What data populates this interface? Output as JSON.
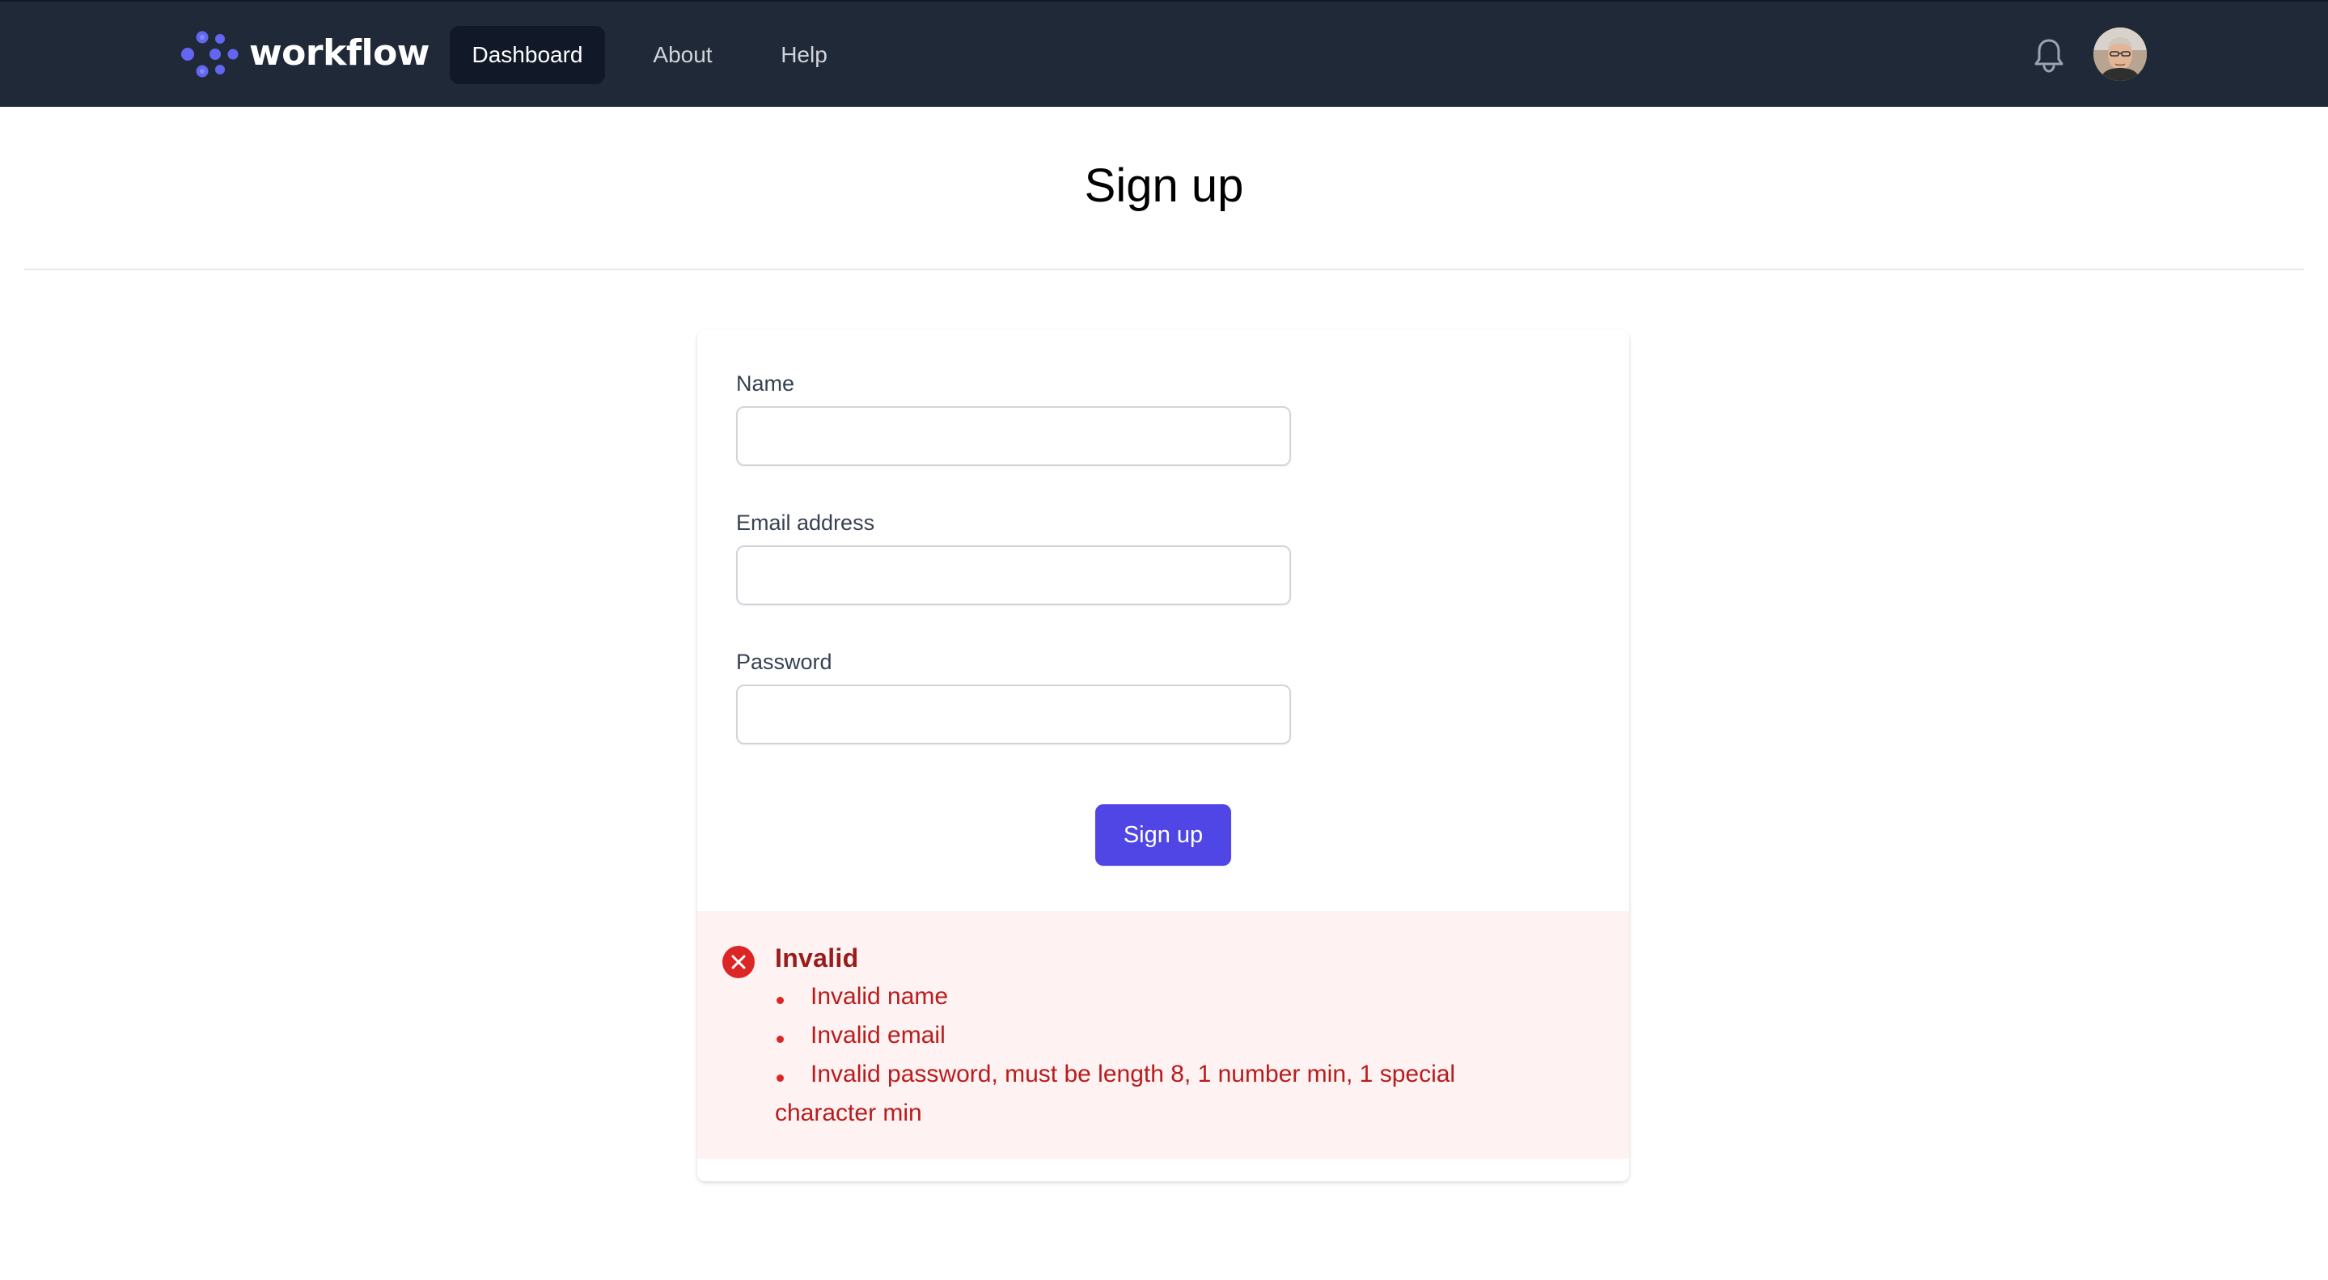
{
  "app": {
    "brand": "workflow",
    "brand_color": "#6366f1"
  },
  "navbar": {
    "background": "#1f2937",
    "links": [
      {
        "label": "Dashboard",
        "active": true
      },
      {
        "label": "About",
        "active": false
      },
      {
        "label": "Help",
        "active": false
      }
    ],
    "notification_icon": "bell-icon",
    "avatar": "user-avatar"
  },
  "page": {
    "title": "Sign up"
  },
  "form": {
    "fields": [
      {
        "label": "Name",
        "value": "",
        "placeholder": ""
      },
      {
        "label": "Email address",
        "value": "",
        "placeholder": ""
      },
      {
        "label": "Password",
        "value": "",
        "placeholder": ""
      }
    ],
    "submit_label": "Sign up",
    "submit_color": "#4f46e5"
  },
  "alert": {
    "icon": "x-circle-icon",
    "title": "Invalid",
    "color": "#dc2626",
    "errors": [
      "Invalid name",
      "Invalid email",
      "Invalid password, must be length 8, 1 number min, 1 special character min"
    ]
  }
}
